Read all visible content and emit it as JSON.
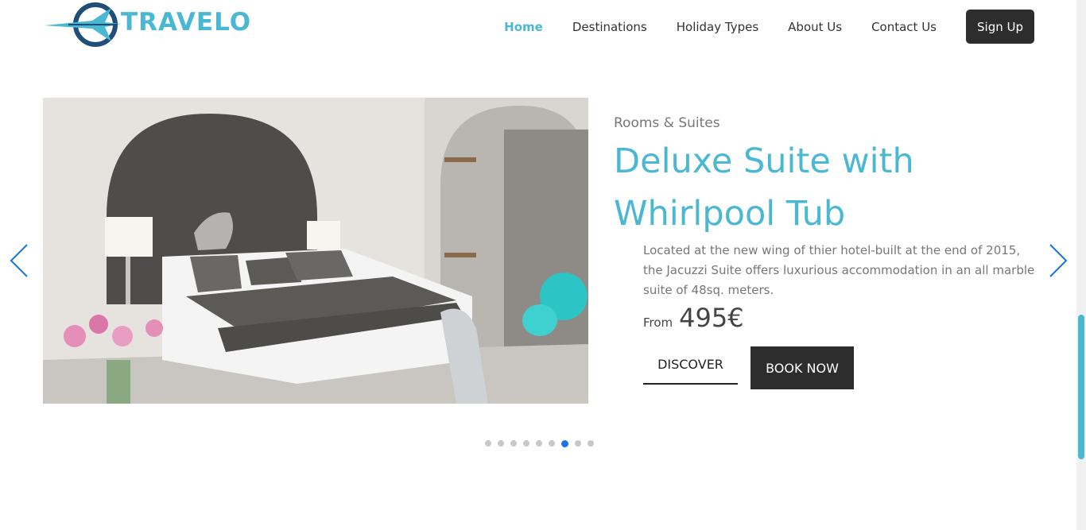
{
  "brand": {
    "name": "TRAVELO",
    "accent_color": "#4bb8d3",
    "icon": "airplane-logo-icon"
  },
  "nav": {
    "items": [
      {
        "label": "Home",
        "active": true
      },
      {
        "label": "Destinations",
        "active": false
      },
      {
        "label": "Holiday Types",
        "active": false
      },
      {
        "label": "About Us",
        "active": false
      },
      {
        "label": "Contact Us",
        "active": false
      }
    ],
    "signup_label": "Sign Up"
  },
  "slide": {
    "kicker": "Rooms & Suites",
    "title": "Deluxe Suite with Whirlpool Tub",
    "description": "Located at the new wing of thier hotel-built at the end of 2015, the Jacuzzi Suite offers luxurious accommodation in an all marble suite of 48sq. meters.",
    "price_prefix": "From",
    "price": "495€",
    "discover_label": "DISCOVER",
    "book_label": "BOOK NOW"
  },
  "carousel": {
    "total_slides": 9,
    "active_index": 6,
    "prev_icon": "chevron-left-icon",
    "next_icon": "chevron-right-icon",
    "dot_active_color": "#1a73e8"
  }
}
